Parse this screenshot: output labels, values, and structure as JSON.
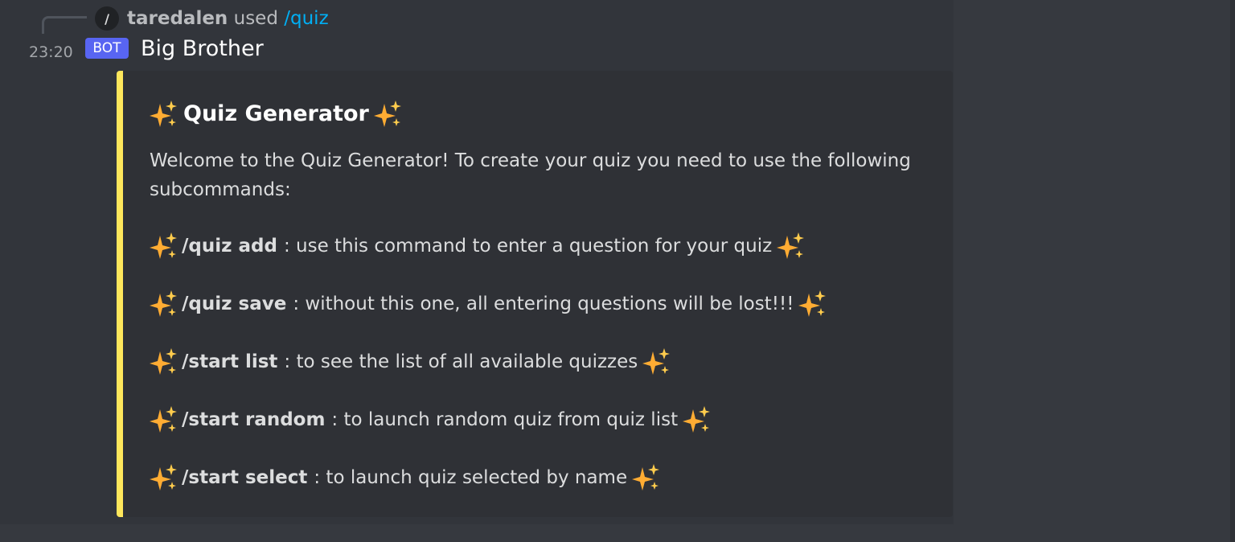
{
  "reply": {
    "username": "taredalen",
    "used_text": "used",
    "command": "/quiz"
  },
  "message": {
    "timestamp": "23:20",
    "bot_tag": "BOT",
    "author": "Big Brother"
  },
  "embed": {
    "accent_color": "#fee75c",
    "title": "Quiz Generator",
    "description": "Welcome to the Quiz Generator! To create your quiz you need to use the following subcommands:",
    "commands": [
      {
        "name": "/quiz add",
        "description": ": use this command to enter a question for your quiz"
      },
      {
        "name": "/quiz save",
        "description": ": without this one, all entering questions will be lost!!!"
      },
      {
        "name": "/start list",
        "description": ": to see the list of all available quizzes"
      },
      {
        "name": "/start random",
        "description": ": to launch random quiz from quiz list"
      },
      {
        "name": "/start select",
        "description": ": to launch quiz selected by name"
      }
    ]
  },
  "icons": {
    "sparkle": "sparkles-emoji",
    "command": "slash-command-icon"
  }
}
